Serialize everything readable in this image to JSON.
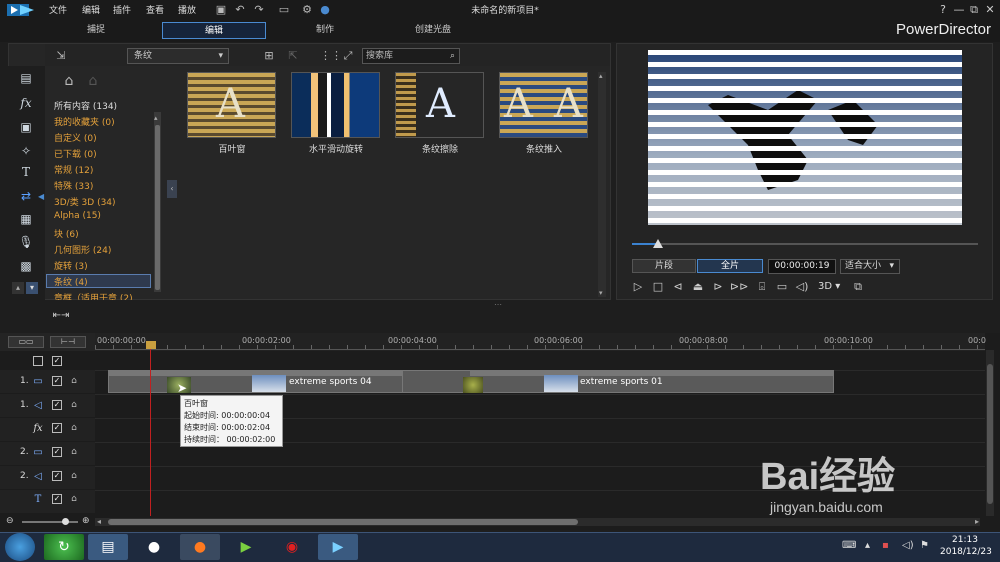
{
  "titlebar": {
    "menus": [
      "文件",
      "编辑",
      "插件",
      "查看",
      "播放"
    ],
    "window_title": "未命名的新项目*",
    "controls": [
      "?",
      "—",
      "⧉",
      "✕"
    ]
  },
  "modes": {
    "tabs": [
      "捕捉",
      "编辑",
      "制作",
      "创建光盘"
    ],
    "brand": "PowerDirector"
  },
  "library": {
    "category_select": "条纹",
    "search_placeholder": "搜索库",
    "categories": [
      {
        "label": "所有内容 (134)"
      },
      {
        "label": "我的收藏夹 (0)"
      },
      {
        "label": "自定义 (0)"
      },
      {
        "label": "已下载 (0)"
      },
      {
        "label": "常规 (12)"
      },
      {
        "label": "特殊 (33)"
      },
      {
        "label": "3D/类 3D (34)"
      },
      {
        "label": "Alpha (15)"
      },
      {
        "label": "块 (6)"
      },
      {
        "label": "几何图形 (24)"
      },
      {
        "label": "旋转 (3)"
      },
      {
        "label": "条纹 (4)"
      },
      {
        "label": "章框（适用于章 (2)"
      }
    ],
    "items": [
      {
        "label": "百叶窗"
      },
      {
        "label": "水平滑动旋转"
      },
      {
        "label": "条纹擦除"
      },
      {
        "label": "条纹推入"
      }
    ]
  },
  "preview": {
    "seg_clip": "片段",
    "seg_full": "全片",
    "timecode": "00:00:00:19",
    "fit": "适合大小",
    "mode3d": "3D"
  },
  "timeline": {
    "ruler": [
      "00:00:00:00",
      "00:00:02:00",
      "00:00:04:00",
      "00:00:06:00",
      "00:00:08:00",
      "00:00:10:00",
      "00:0"
    ],
    "tracks": [
      {
        "num": "1.",
        "icon": "video-track-icon"
      },
      {
        "num": "1.",
        "icon": "audio-track-icon"
      },
      {
        "num": "",
        "icon": "fx-track-icon"
      },
      {
        "num": "2.",
        "icon": "video-track-icon"
      },
      {
        "num": "2.",
        "icon": "audio-track-icon"
      },
      {
        "num": "",
        "icon": "title-track-icon"
      }
    ],
    "clips": [
      {
        "title": "extreme sports 04"
      },
      {
        "title": "extreme sports 01"
      }
    ],
    "tooltip": {
      "name": "百叶窗",
      "start": "起始时间: 00:00:00:04",
      "end": "结束时间: 00:00:02:04",
      "duration": "持续时间： 00:00:02:00"
    }
  },
  "taskbar": {
    "time": "21:13",
    "date": "2018/12/23"
  },
  "watermark": {
    "text": "Bai经验",
    "url": "jingyan.baidu.com"
  }
}
